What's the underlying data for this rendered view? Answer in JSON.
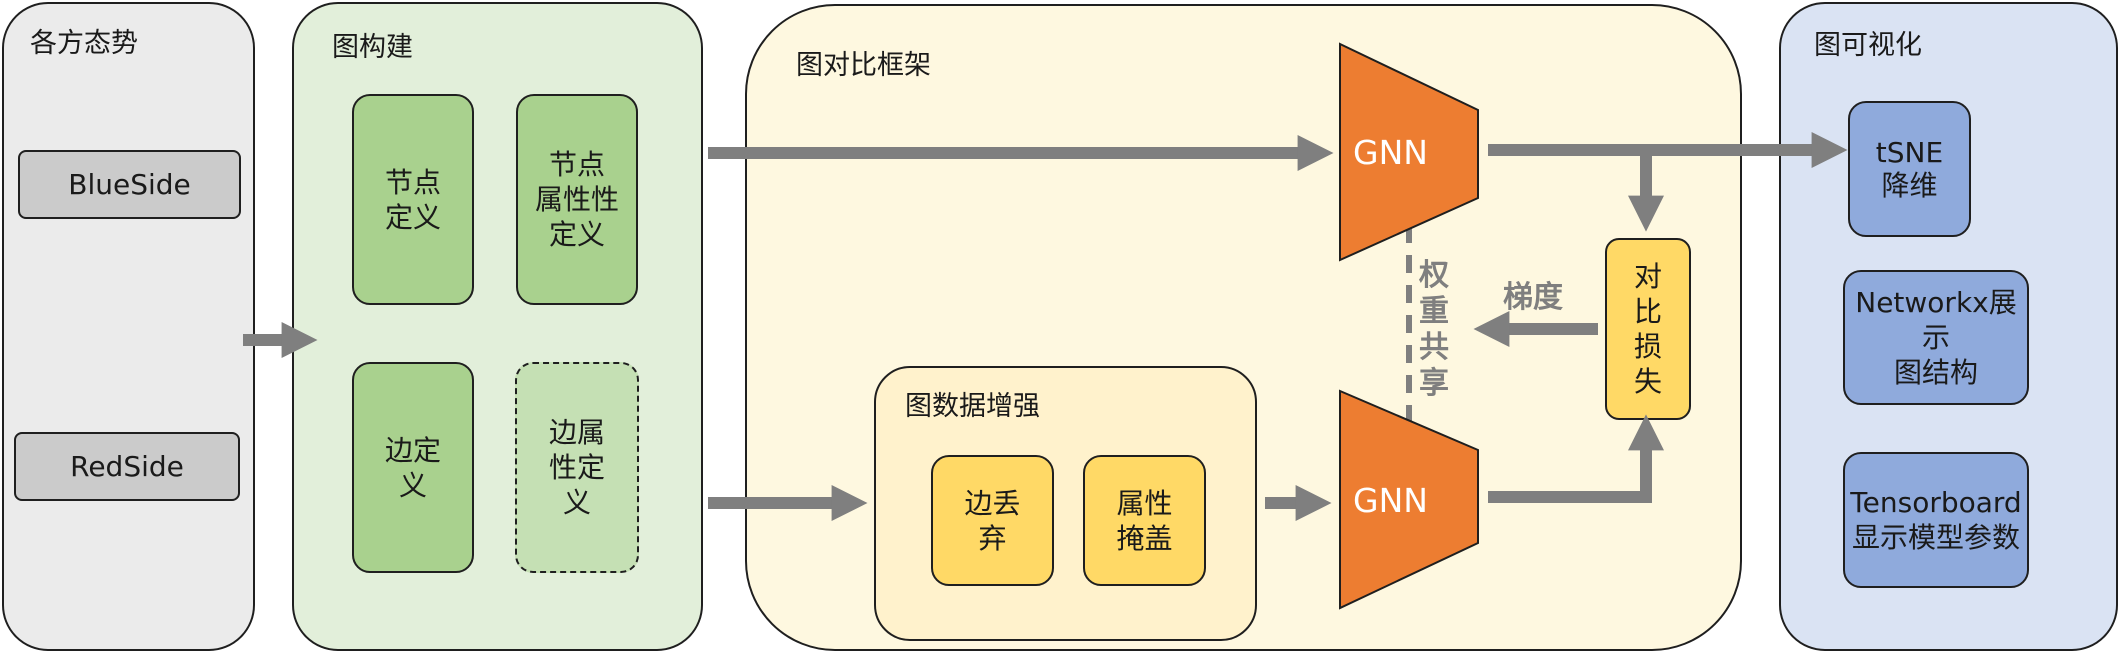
{
  "panels": {
    "situation": {
      "title": "各方态势",
      "blue_side": "BlueSide",
      "red_side": "RedSide"
    },
    "graph_build": {
      "title": "图构建",
      "node_def": "节点\n定义",
      "node_attr_def": "节点\n属性性\n定义",
      "edge_def": "边定\n义",
      "edge_attr_def": "边属\n性定\n义"
    },
    "contrastive": {
      "title": "图对比框架",
      "gnn_top": "GNN",
      "gnn_bottom": "GNN",
      "weight_share": "权\n重\n共\n享",
      "gradient": "梯度",
      "loss": "对\n比\n损\n失",
      "augment": {
        "title": "图数据增强",
        "edge_drop": "边丢\n弃",
        "attr_mask": "属性\n掩盖"
      }
    },
    "visualization": {
      "title": "图可视化",
      "tsne": "tSNE\n降维",
      "networkx": "Networkx展示\n图结构",
      "tensorboard": "Tensorboard\n显示模型参数"
    }
  },
  "colors": {
    "gray_panel": "#ebebeb",
    "green_panel": "#e2efda",
    "yellow_panel": "#fef8e0",
    "blue_panel": "#dae3f3",
    "gnn_orange": "#ed7d31",
    "arrow_gray": "#7f7f7f"
  }
}
